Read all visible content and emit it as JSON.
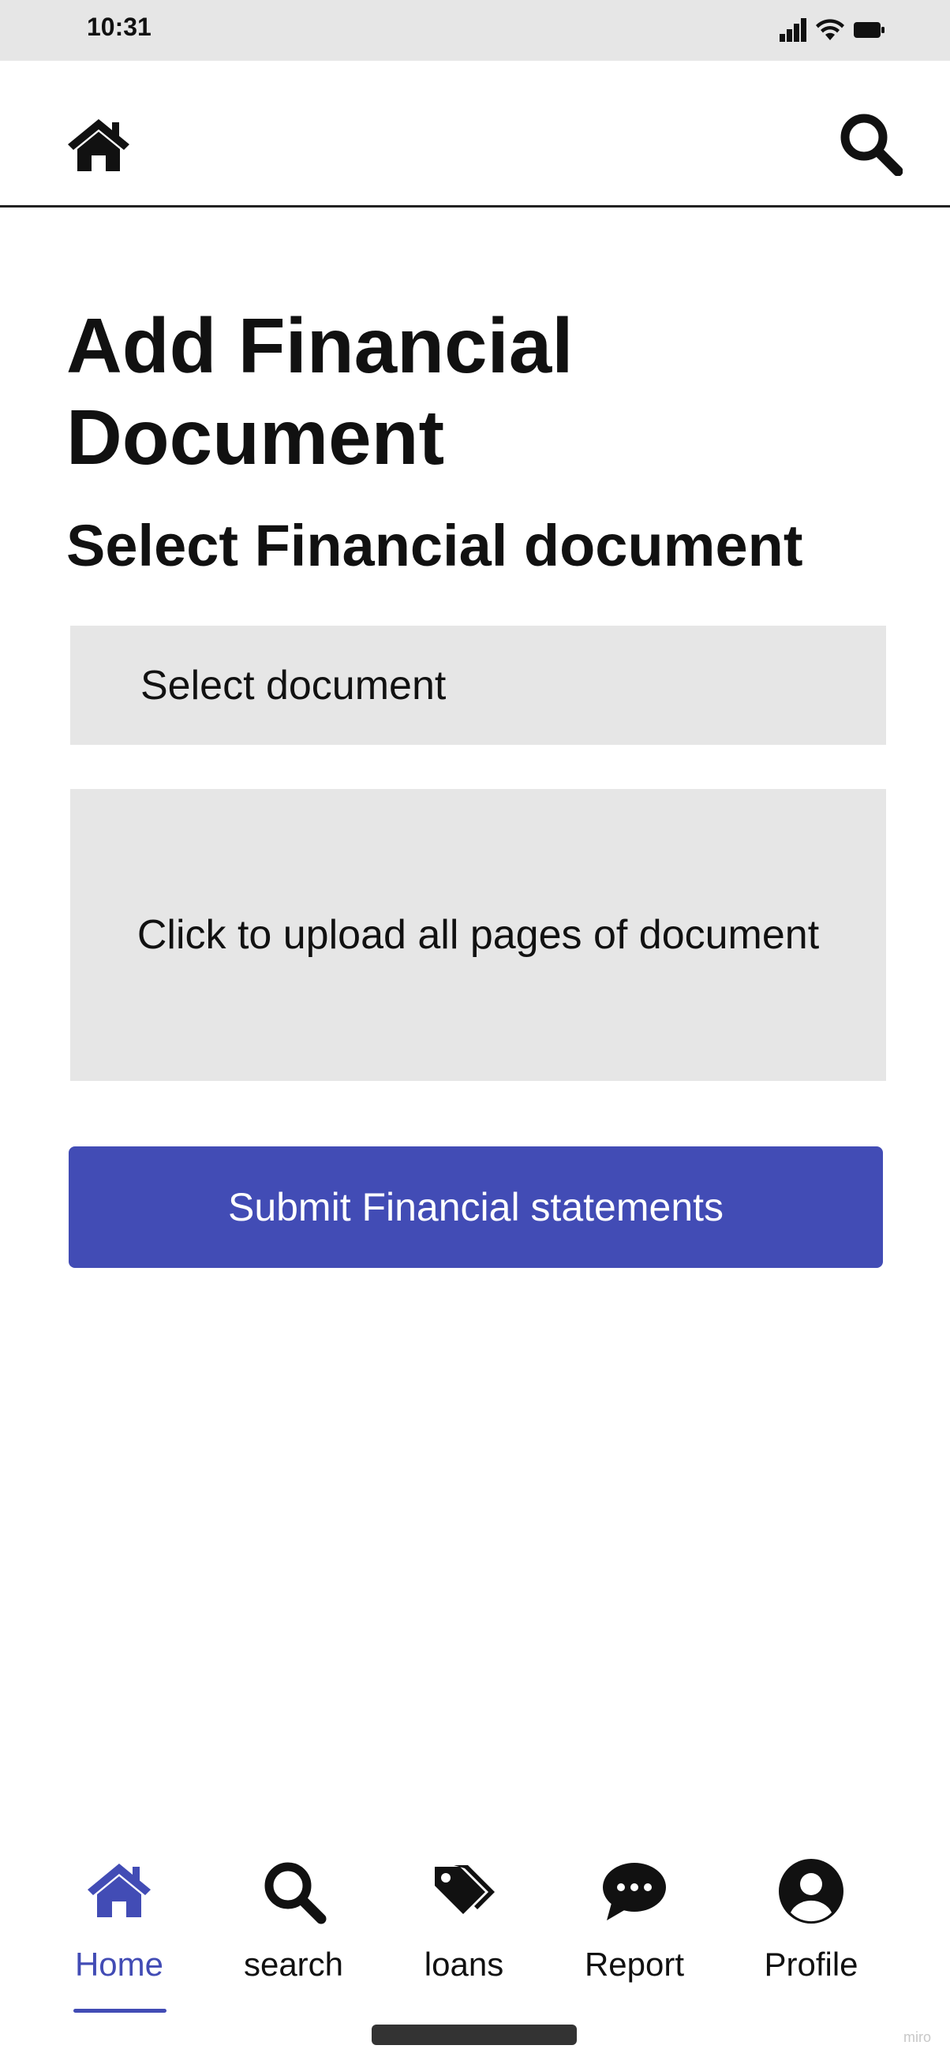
{
  "status_bar": {
    "time": "10:31",
    "icons": [
      "cellular-signal-icon",
      "wifi-icon",
      "battery-icon"
    ]
  },
  "top_nav": {
    "left_icon": "home-icon",
    "right_icon": "search-icon"
  },
  "page": {
    "title": "Add Financial Document",
    "subtitle": "Select Financial document",
    "select_placeholder": "Select document",
    "upload_label": "Click to upload all pages of document",
    "submit_label": "Submit Financial statements"
  },
  "bottom_nav": {
    "active": "Home",
    "items": [
      {
        "label": "Home",
        "icon": "home-icon"
      },
      {
        "label": "search",
        "icon": "search-icon"
      },
      {
        "label": "loans",
        "icon": "tags-icon"
      },
      {
        "label": "Report",
        "icon": "chat-bubble-icon"
      },
      {
        "label": "Profile",
        "icon": "user-circle-icon"
      }
    ]
  },
  "colors": {
    "accent": "#424cb5",
    "panel": "#e6e6e6",
    "status_bar": "#e6e6e6",
    "text": "#111111"
  },
  "watermark": "miro"
}
